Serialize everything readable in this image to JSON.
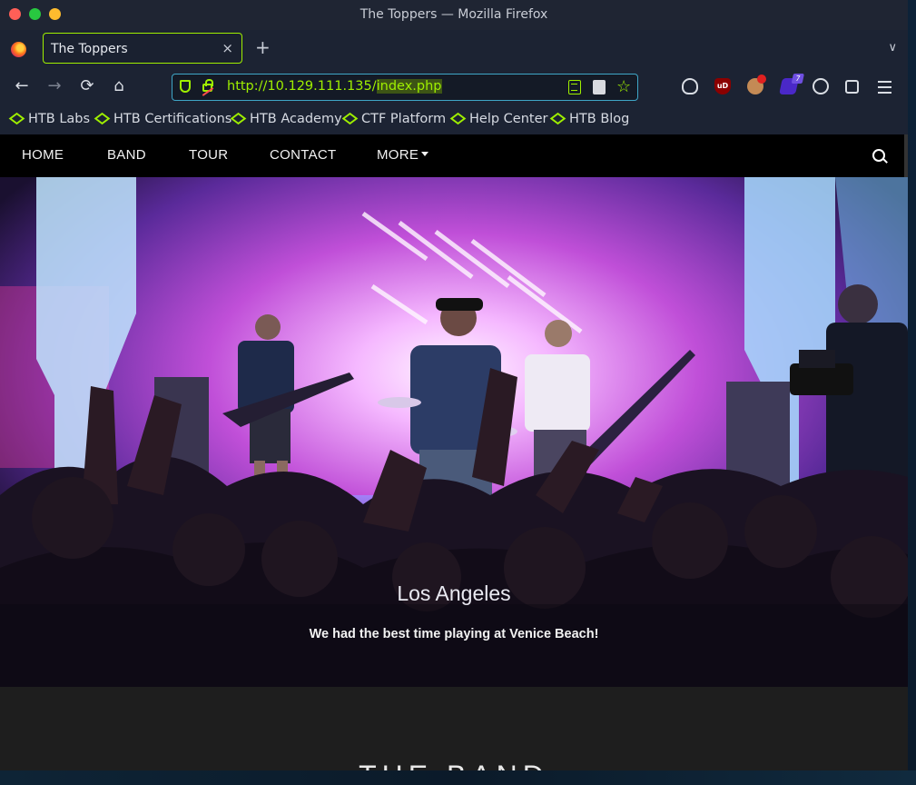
{
  "window": {
    "title": "The Toppers — Mozilla Firefox"
  },
  "tabs": [
    {
      "label": "The Toppers",
      "close": "×"
    }
  ],
  "new_tab": "+",
  "address_bar": {
    "url_prefix": "http://10.129.111.135/",
    "url_highlight": "index.php"
  },
  "toolbar": {
    "back": "←",
    "forward": "→",
    "reload": "⟳",
    "home": "⌂",
    "bookmark_star": "☆"
  },
  "extensions": [
    "shield-ext-icon",
    "ublock-icon",
    "cookie-ext-icon",
    "purple-ext-icon",
    "cookie-icon",
    "extensions-icon"
  ],
  "extension_badges": {
    "ublock": "uD",
    "purple": "7"
  },
  "bookmarks": [
    "HTB Labs",
    "HTB Certifications",
    "HTB Academy",
    "CTF Platform",
    "Help Center",
    "HTB Blog"
  ],
  "site_nav": {
    "home": "HOME",
    "band": "BAND",
    "tour": "TOUR",
    "contact": "CONTACT",
    "more": "MORE"
  },
  "hero": {
    "caption_title": "Los Angeles",
    "caption_text": "We had the best time playing at Venice Beach!"
  },
  "section": {
    "title": "THE BAND"
  },
  "colors": {
    "accent": "#9fef00",
    "urlbar_border": "#3fa6c7",
    "nav_bg": "#000000"
  }
}
